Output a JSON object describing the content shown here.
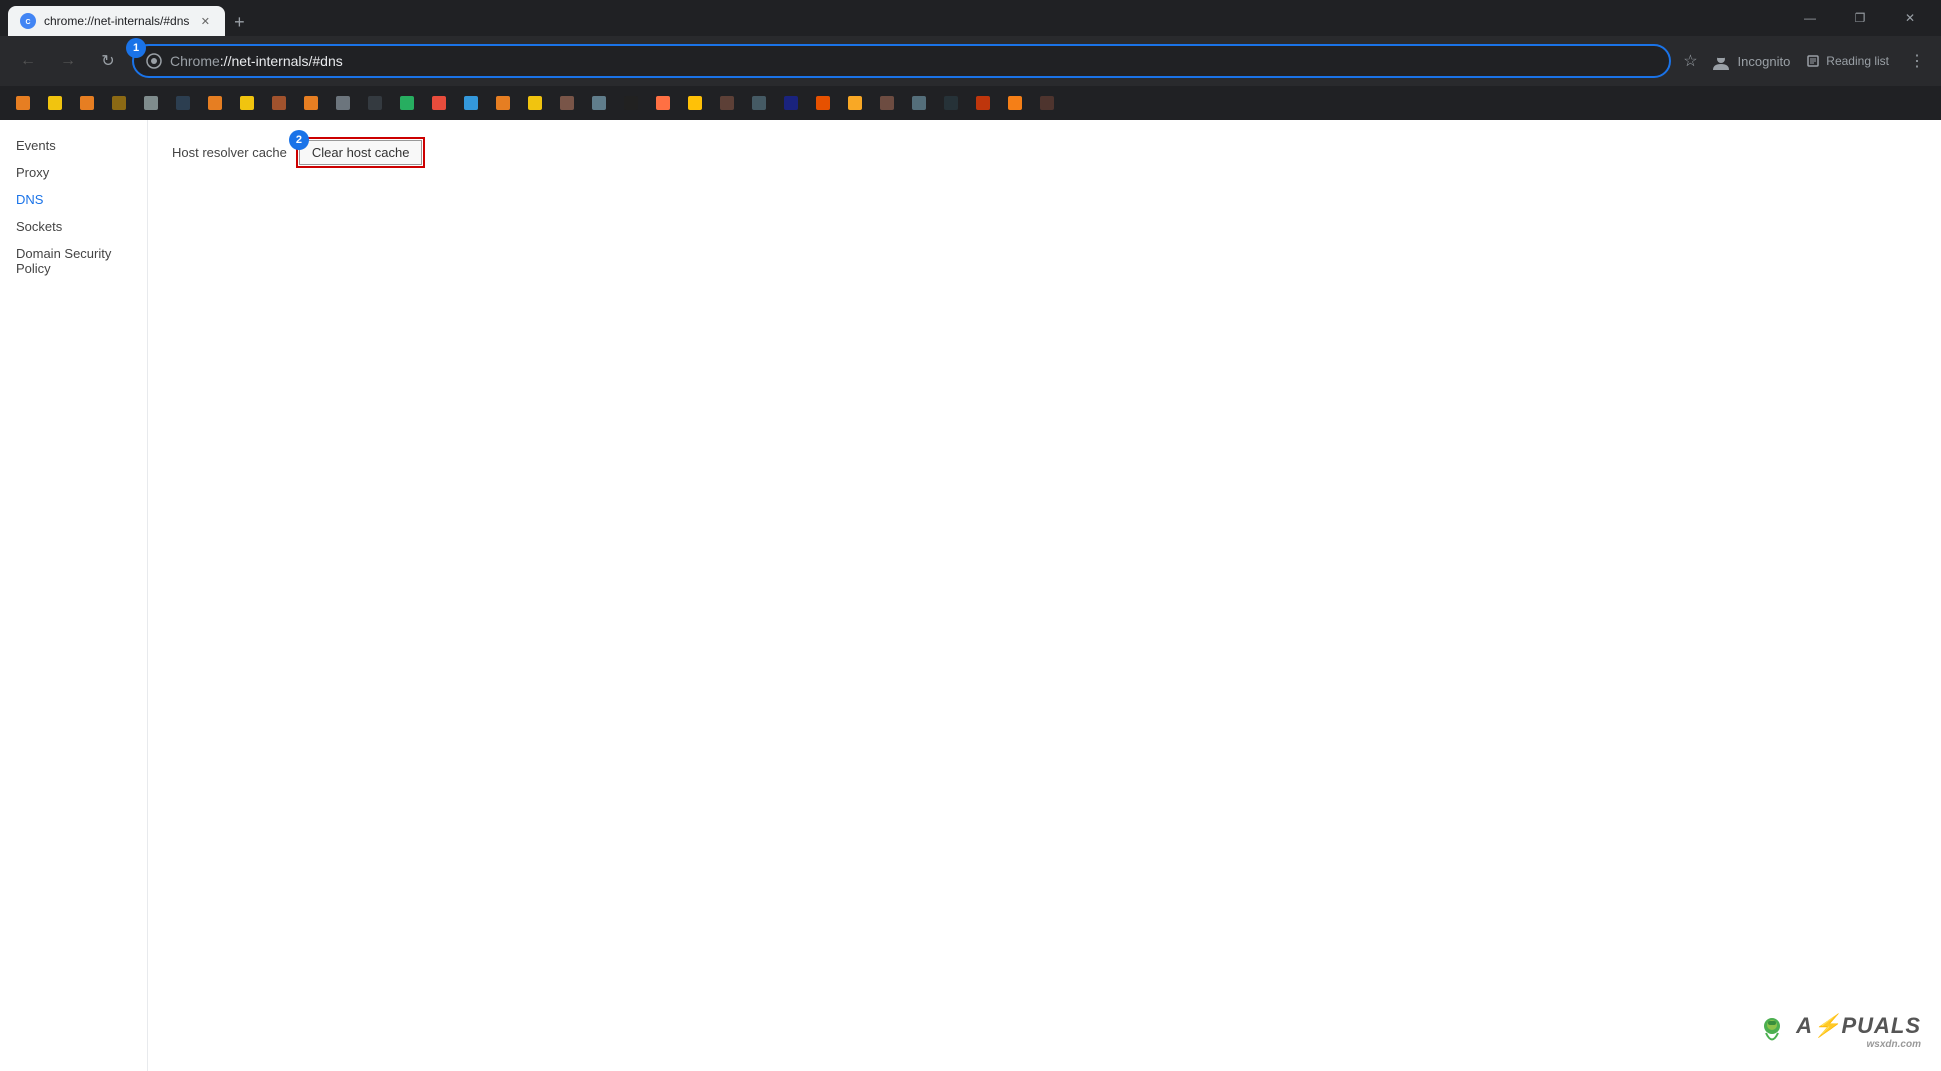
{
  "browser": {
    "title_bar": {
      "tab_title": "chrome://net-internals/#dns",
      "new_tab_label": "+",
      "win_minimize": "—",
      "win_restore": "❐",
      "win_close": "✕"
    },
    "address_bar": {
      "url": "chrome://net-internals/#dns",
      "url_display": "chrome://net-internals/#dns",
      "incognito_label": "Incognito",
      "step1_badge": "1",
      "reading_list_label": "Reading list"
    },
    "sidebar": {
      "items": [
        {
          "id": "events",
          "label": "Events",
          "active": false
        },
        {
          "id": "proxy",
          "label": "Proxy",
          "active": false
        },
        {
          "id": "dns",
          "label": "DNS",
          "active": true
        },
        {
          "id": "sockets",
          "label": "Sockets",
          "active": false
        },
        {
          "id": "domain-security-policy",
          "label": "Domain Security Policy",
          "active": false
        }
      ]
    },
    "content": {
      "host_resolver_label": "Host resolver cache",
      "clear_cache_btn_label": "Clear host cache",
      "step2_badge": "2"
    },
    "watermark": {
      "text": "A⚡PUALS",
      "domain": "wsxdn.com"
    }
  },
  "bookmarks": [
    {
      "id": 1,
      "color": "bm-orange",
      "label": ""
    },
    {
      "id": 2,
      "color": "bm-yellow",
      "label": ""
    },
    {
      "id": 3,
      "color": "bm-orange",
      "label": ""
    },
    {
      "id": 4,
      "color": "bm-brown",
      "label": ""
    },
    {
      "id": 5,
      "color": "bm-gray",
      "label": ""
    },
    {
      "id": 6,
      "color": "bm-dark",
      "label": ""
    },
    {
      "id": 7,
      "color": "bm-orange",
      "label": ""
    },
    {
      "id": 8,
      "color": "bm-yellow",
      "label": ""
    },
    {
      "id": 9,
      "color": "bm-brown",
      "label": ""
    },
    {
      "id": 10,
      "color": "bm-orange",
      "label": ""
    },
    {
      "id": 11,
      "color": "bm-gray",
      "label": ""
    },
    {
      "id": 12,
      "color": "bm-dark",
      "label": ""
    },
    {
      "id": 13,
      "color": "bm-green",
      "label": ""
    },
    {
      "id": 14,
      "color": "bm-red",
      "label": ""
    },
    {
      "id": 15,
      "color": "bm-blue",
      "label": ""
    },
    {
      "id": 16,
      "color": "bm-orange",
      "label": ""
    },
    {
      "id": 17,
      "color": "bm-yellow",
      "label": ""
    },
    {
      "id": 18,
      "color": "bm-brown",
      "label": ""
    },
    {
      "id": 19,
      "color": "bm-gray",
      "label": ""
    },
    {
      "id": 20,
      "color": "bm-dark",
      "label": ""
    }
  ]
}
